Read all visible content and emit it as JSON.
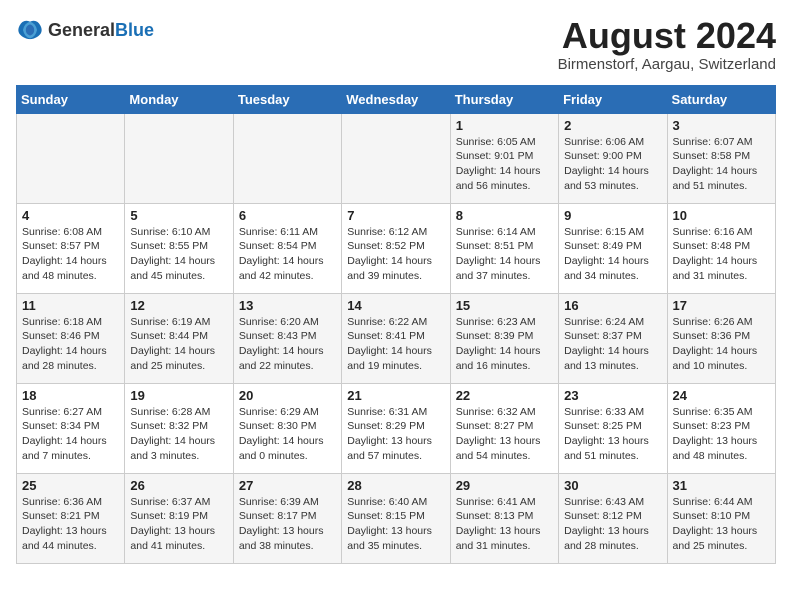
{
  "header": {
    "logo": {
      "general": "General",
      "blue": "Blue"
    },
    "title": "August 2024",
    "location": "Birmenstorf, Aargau, Switzerland"
  },
  "calendar": {
    "days_of_week": [
      "Sunday",
      "Monday",
      "Tuesday",
      "Wednesday",
      "Thursday",
      "Friday",
      "Saturday"
    ],
    "weeks": [
      [
        {
          "day": "",
          "content": ""
        },
        {
          "day": "",
          "content": ""
        },
        {
          "day": "",
          "content": ""
        },
        {
          "day": "",
          "content": ""
        },
        {
          "day": "1",
          "content": "Sunrise: 6:05 AM\nSunset: 9:01 PM\nDaylight: 14 hours and 56 minutes."
        },
        {
          "day": "2",
          "content": "Sunrise: 6:06 AM\nSunset: 9:00 PM\nDaylight: 14 hours and 53 minutes."
        },
        {
          "day": "3",
          "content": "Sunrise: 6:07 AM\nSunset: 8:58 PM\nDaylight: 14 hours and 51 minutes."
        }
      ],
      [
        {
          "day": "4",
          "content": "Sunrise: 6:08 AM\nSunset: 8:57 PM\nDaylight: 14 hours and 48 minutes."
        },
        {
          "day": "5",
          "content": "Sunrise: 6:10 AM\nSunset: 8:55 PM\nDaylight: 14 hours and 45 minutes."
        },
        {
          "day": "6",
          "content": "Sunrise: 6:11 AM\nSunset: 8:54 PM\nDaylight: 14 hours and 42 minutes."
        },
        {
          "day": "7",
          "content": "Sunrise: 6:12 AM\nSunset: 8:52 PM\nDaylight: 14 hours and 39 minutes."
        },
        {
          "day": "8",
          "content": "Sunrise: 6:14 AM\nSunset: 8:51 PM\nDaylight: 14 hours and 37 minutes."
        },
        {
          "day": "9",
          "content": "Sunrise: 6:15 AM\nSunset: 8:49 PM\nDaylight: 14 hours and 34 minutes."
        },
        {
          "day": "10",
          "content": "Sunrise: 6:16 AM\nSunset: 8:48 PM\nDaylight: 14 hours and 31 minutes."
        }
      ],
      [
        {
          "day": "11",
          "content": "Sunrise: 6:18 AM\nSunset: 8:46 PM\nDaylight: 14 hours and 28 minutes."
        },
        {
          "day": "12",
          "content": "Sunrise: 6:19 AM\nSunset: 8:44 PM\nDaylight: 14 hours and 25 minutes."
        },
        {
          "day": "13",
          "content": "Sunrise: 6:20 AM\nSunset: 8:43 PM\nDaylight: 14 hours and 22 minutes."
        },
        {
          "day": "14",
          "content": "Sunrise: 6:22 AM\nSunset: 8:41 PM\nDaylight: 14 hours and 19 minutes."
        },
        {
          "day": "15",
          "content": "Sunrise: 6:23 AM\nSunset: 8:39 PM\nDaylight: 14 hours and 16 minutes."
        },
        {
          "day": "16",
          "content": "Sunrise: 6:24 AM\nSunset: 8:37 PM\nDaylight: 14 hours and 13 minutes."
        },
        {
          "day": "17",
          "content": "Sunrise: 6:26 AM\nSunset: 8:36 PM\nDaylight: 14 hours and 10 minutes."
        }
      ],
      [
        {
          "day": "18",
          "content": "Sunrise: 6:27 AM\nSunset: 8:34 PM\nDaylight: 14 hours and 7 minutes."
        },
        {
          "day": "19",
          "content": "Sunrise: 6:28 AM\nSunset: 8:32 PM\nDaylight: 14 hours and 3 minutes."
        },
        {
          "day": "20",
          "content": "Sunrise: 6:29 AM\nSunset: 8:30 PM\nDaylight: 14 hours and 0 minutes."
        },
        {
          "day": "21",
          "content": "Sunrise: 6:31 AM\nSunset: 8:29 PM\nDaylight: 13 hours and 57 minutes."
        },
        {
          "day": "22",
          "content": "Sunrise: 6:32 AM\nSunset: 8:27 PM\nDaylight: 13 hours and 54 minutes."
        },
        {
          "day": "23",
          "content": "Sunrise: 6:33 AM\nSunset: 8:25 PM\nDaylight: 13 hours and 51 minutes."
        },
        {
          "day": "24",
          "content": "Sunrise: 6:35 AM\nSunset: 8:23 PM\nDaylight: 13 hours and 48 minutes."
        }
      ],
      [
        {
          "day": "25",
          "content": "Sunrise: 6:36 AM\nSunset: 8:21 PM\nDaylight: 13 hours and 44 minutes."
        },
        {
          "day": "26",
          "content": "Sunrise: 6:37 AM\nSunset: 8:19 PM\nDaylight: 13 hours and 41 minutes."
        },
        {
          "day": "27",
          "content": "Sunrise: 6:39 AM\nSunset: 8:17 PM\nDaylight: 13 hours and 38 minutes."
        },
        {
          "day": "28",
          "content": "Sunrise: 6:40 AM\nSunset: 8:15 PM\nDaylight: 13 hours and 35 minutes."
        },
        {
          "day": "29",
          "content": "Sunrise: 6:41 AM\nSunset: 8:13 PM\nDaylight: 13 hours and 31 minutes."
        },
        {
          "day": "30",
          "content": "Sunrise: 6:43 AM\nSunset: 8:12 PM\nDaylight: 13 hours and 28 minutes."
        },
        {
          "day": "31",
          "content": "Sunrise: 6:44 AM\nSunset: 8:10 PM\nDaylight: 13 hours and 25 minutes."
        }
      ]
    ]
  }
}
